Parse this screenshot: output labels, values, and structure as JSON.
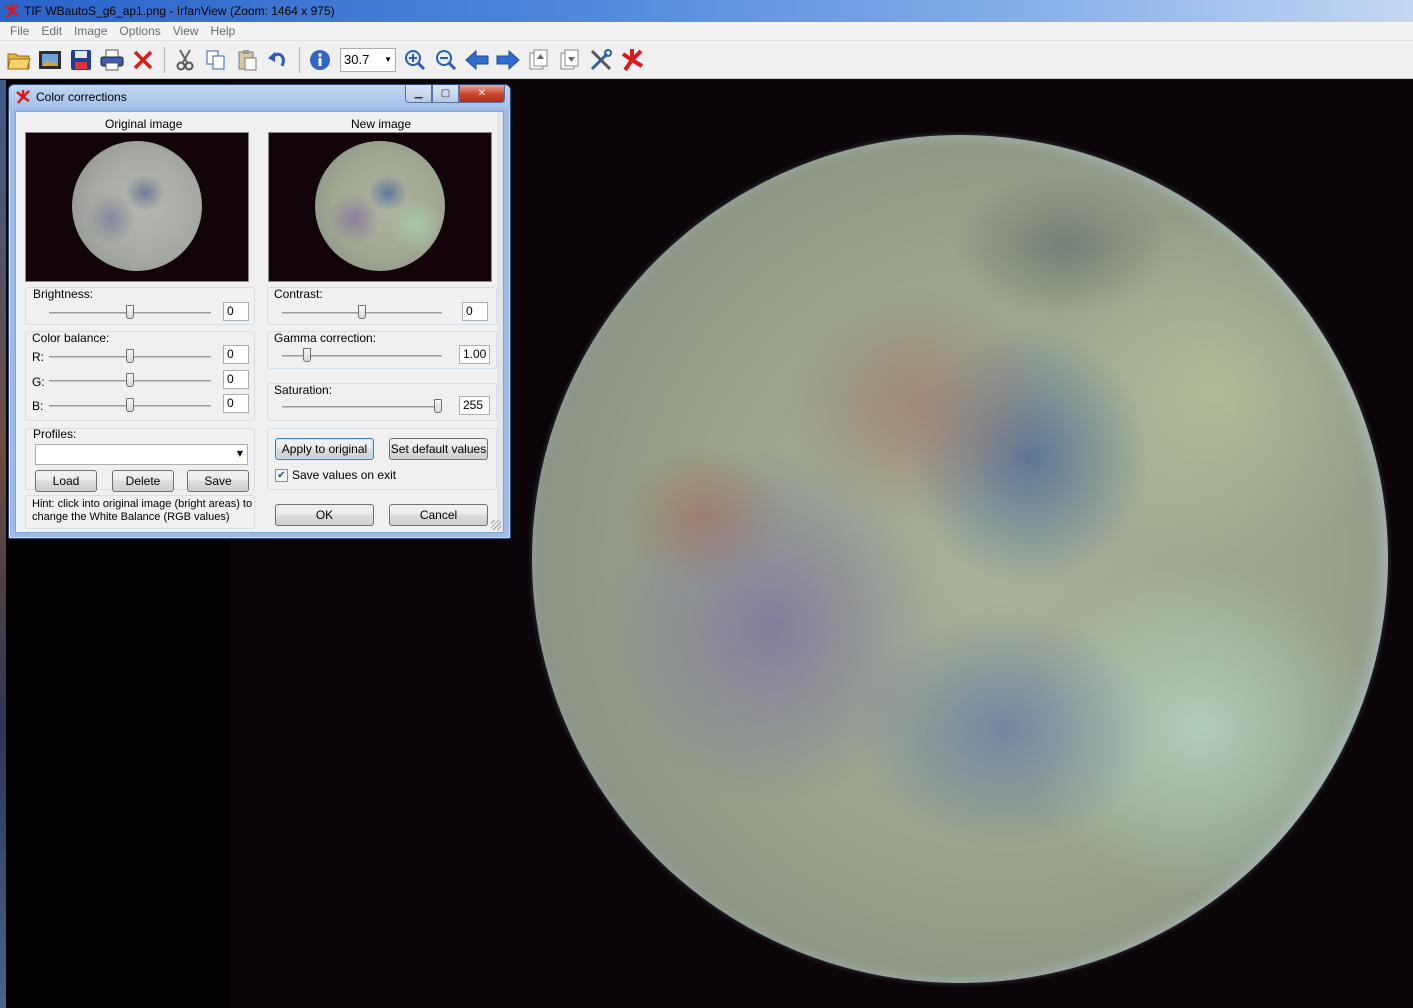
{
  "window": {
    "title": "TIF WBautoS_g6_ap1.png - IrfanView (Zoom: 1464 x 975)"
  },
  "menu": {
    "items": [
      "File",
      "Edit",
      "Image",
      "Options",
      "View",
      "Help"
    ]
  },
  "toolbar": {
    "zoom_value": "30.7",
    "icons": [
      "open-folder-icon",
      "slideshow-icon",
      "save-icon",
      "print-icon",
      "delete-icon",
      "cut-icon",
      "copy-icon",
      "paste-icon",
      "undo-icon",
      "info-icon",
      "zoom-in-icon",
      "zoom-out-icon",
      "previous-icon",
      "next-icon",
      "page-up-icon",
      "page-down-icon",
      "settings-icon",
      "irfanview-logo-icon"
    ]
  },
  "dialog": {
    "title": "Color corrections",
    "original_label": "Original image",
    "new_label": "New image",
    "brightness": {
      "label": "Brightness:",
      "value": "0",
      "level": 0.5
    },
    "contrast": {
      "label": "Contrast:",
      "value": "0",
      "level": 0.5
    },
    "color_balance": {
      "label": "Color balance:",
      "r_label": "R:",
      "r_value": "0",
      "g_label": "G:",
      "g_value": "0",
      "b_label": "B:",
      "b_value": "0"
    },
    "gamma": {
      "label": "Gamma correction:",
      "value": "1.00"
    },
    "saturation": {
      "label": "Saturation:",
      "value": "255"
    },
    "profiles": {
      "label": "Profiles:",
      "selected": "",
      "load_label": "Load",
      "delete_label": "Delete",
      "save_label": "Save"
    },
    "apply_label": "Apply to original",
    "default_label": "Set default values",
    "save_on_exit_label": "Save values on exit",
    "save_on_exit_checked": true,
    "hint_line1": "Hint: click into original image (bright areas) to",
    "hint_line2": "change the White Balance (RGB values)",
    "ok_label": "OK",
    "cancel_label": "Cancel"
  }
}
